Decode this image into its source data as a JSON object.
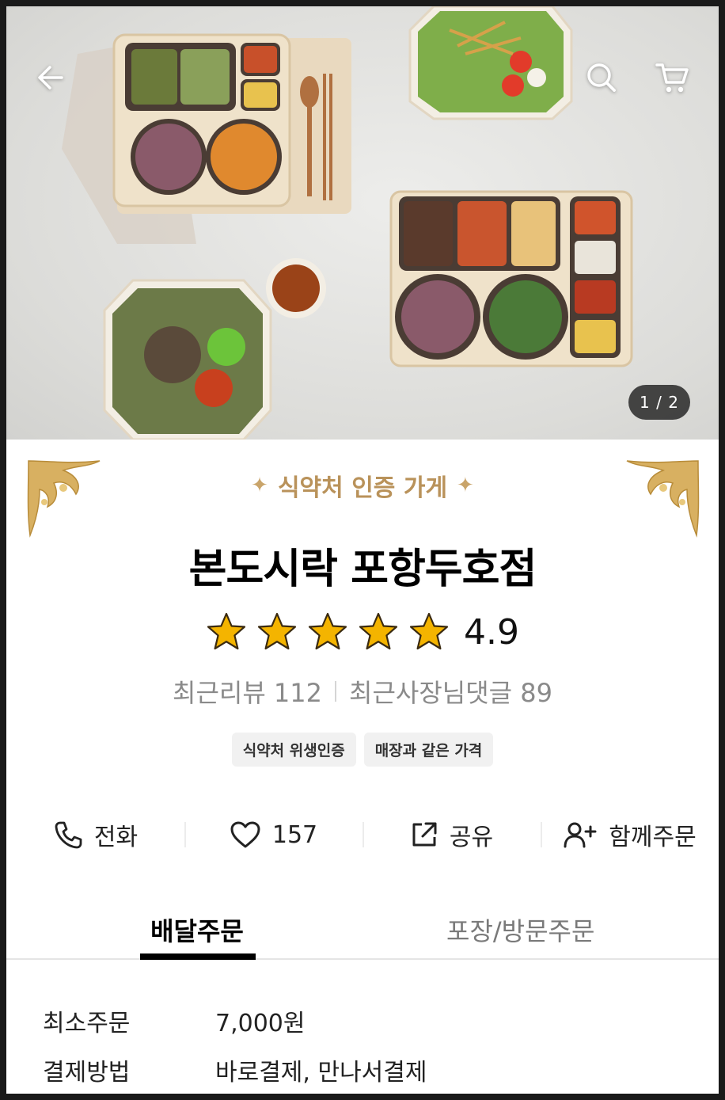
{
  "hero": {
    "image_alt": "food-photo",
    "page_counter": "1 / 2"
  },
  "store": {
    "certification_banner": "식약처 인증 가게",
    "name": "본도시락 포항두호점",
    "rating": "4.9",
    "rating_stars": 5,
    "recent_reviews_label": "최근리뷰 112",
    "owner_replies_label": "최근사장님댓글 89",
    "badges": [
      "식약처 위생인증",
      "매장과 같은 가격"
    ]
  },
  "actions": {
    "call_label": "전화",
    "like_count": "157",
    "share_label": "공유",
    "group_order_label": "함께주문"
  },
  "tabs": {
    "delivery": "배달주문",
    "pickup": "포장/방문주문",
    "active": "delivery"
  },
  "info": {
    "rows": [
      {
        "label": "최소주문",
        "value": "7,000원"
      },
      {
        "label": "결제방법",
        "value": "바로결제, 만나서결제"
      }
    ]
  },
  "colors": {
    "gold_accent": "#b9925a",
    "star_fill": "#f4b400",
    "tab_indicator": "#000000"
  }
}
